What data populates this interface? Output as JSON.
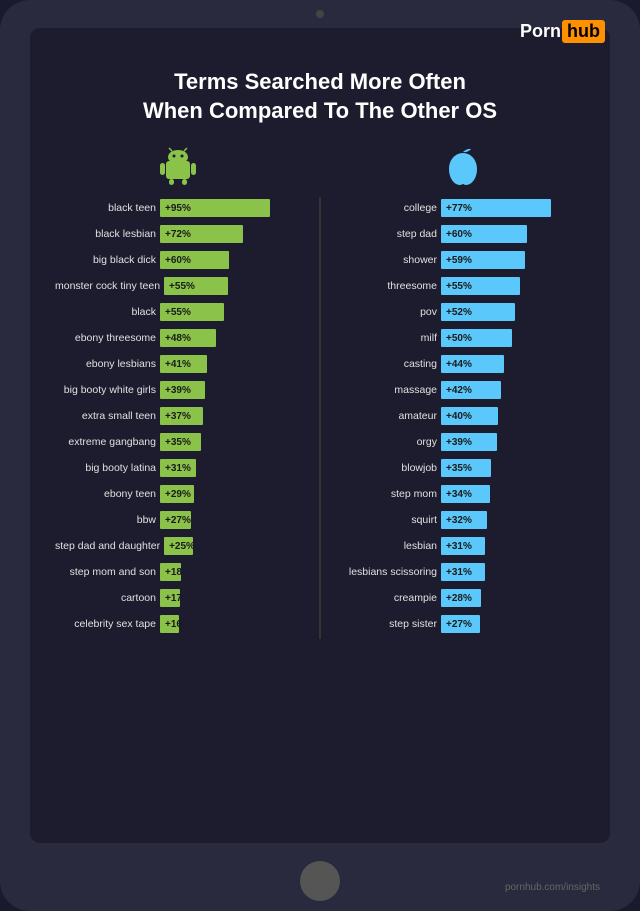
{
  "logo": {
    "porn": "Porn",
    "hub": "hub"
  },
  "title": {
    "line1": "Terms Searched More Often",
    "line2": "When Compared To The Other OS"
  },
  "android": {
    "icon": "🤖",
    "color": "#8bc34a",
    "terms": [
      {
        "label": "black teen",
        "value": "+95%",
        "pct": 95
      },
      {
        "label": "black lesbian",
        "value": "+72%",
        "pct": 72
      },
      {
        "label": "big black dick",
        "value": "+60%",
        "pct": 60
      },
      {
        "label": "monster cock tiny teen",
        "value": "+55%",
        "pct": 55
      },
      {
        "label": "black",
        "value": "+55%",
        "pct": 55
      },
      {
        "label": "ebony threesome",
        "value": "+48%",
        "pct": 48
      },
      {
        "label": "ebony lesbians",
        "value": "+41%",
        "pct": 41
      },
      {
        "label": "big booty white girls",
        "value": "+39%",
        "pct": 39
      },
      {
        "label": "extra small teen",
        "value": "+37%",
        "pct": 37
      },
      {
        "label": "extreme gangbang",
        "value": "+35%",
        "pct": 35
      },
      {
        "label": "big booty latina",
        "value": "+31%",
        "pct": 31
      },
      {
        "label": "ebony teen",
        "value": "+29%",
        "pct": 29
      },
      {
        "label": "bbw",
        "value": "+27%",
        "pct": 27
      },
      {
        "label": "step dad and daughter",
        "value": "+25%",
        "pct": 25
      },
      {
        "label": "step mom and son",
        "value": "+18",
        "pct": 18
      },
      {
        "label": "cartoon",
        "value": "+17",
        "pct": 17
      },
      {
        "label": "celebrity sex tape",
        "value": "+16",
        "pct": 16
      }
    ]
  },
  "apple": {
    "icon": "🍎",
    "color": "#5ac8fa",
    "terms": [
      {
        "label": "college",
        "value": "+77%",
        "pct": 77
      },
      {
        "label": "step dad",
        "value": "+60%",
        "pct": 60
      },
      {
        "label": "shower",
        "value": "+59%",
        "pct": 59
      },
      {
        "label": "threesome",
        "value": "+55%",
        "pct": 55
      },
      {
        "label": "pov",
        "value": "+52%",
        "pct": 52
      },
      {
        "label": "milf",
        "value": "+50%",
        "pct": 50
      },
      {
        "label": "casting",
        "value": "+44%",
        "pct": 44
      },
      {
        "label": "massage",
        "value": "+42%",
        "pct": 42
      },
      {
        "label": "amateur",
        "value": "+40%",
        "pct": 40
      },
      {
        "label": "orgy",
        "value": "+39%",
        "pct": 39
      },
      {
        "label": "blowjob",
        "value": "+35%",
        "pct": 35
      },
      {
        "label": "step mom",
        "value": "+34%",
        "pct": 34
      },
      {
        "label": "squirt",
        "value": "+32%",
        "pct": 32
      },
      {
        "label": "lesbian",
        "value": "+31%",
        "pct": 31
      },
      {
        "label": "lesbians scissoring",
        "value": "+31%",
        "pct": 31
      },
      {
        "label": "creampie",
        "value": "+28%",
        "pct": 28
      },
      {
        "label": "step sister",
        "value": "+27%",
        "pct": 27
      }
    ]
  },
  "footer": {
    "url": "pornhub.com/insights"
  }
}
